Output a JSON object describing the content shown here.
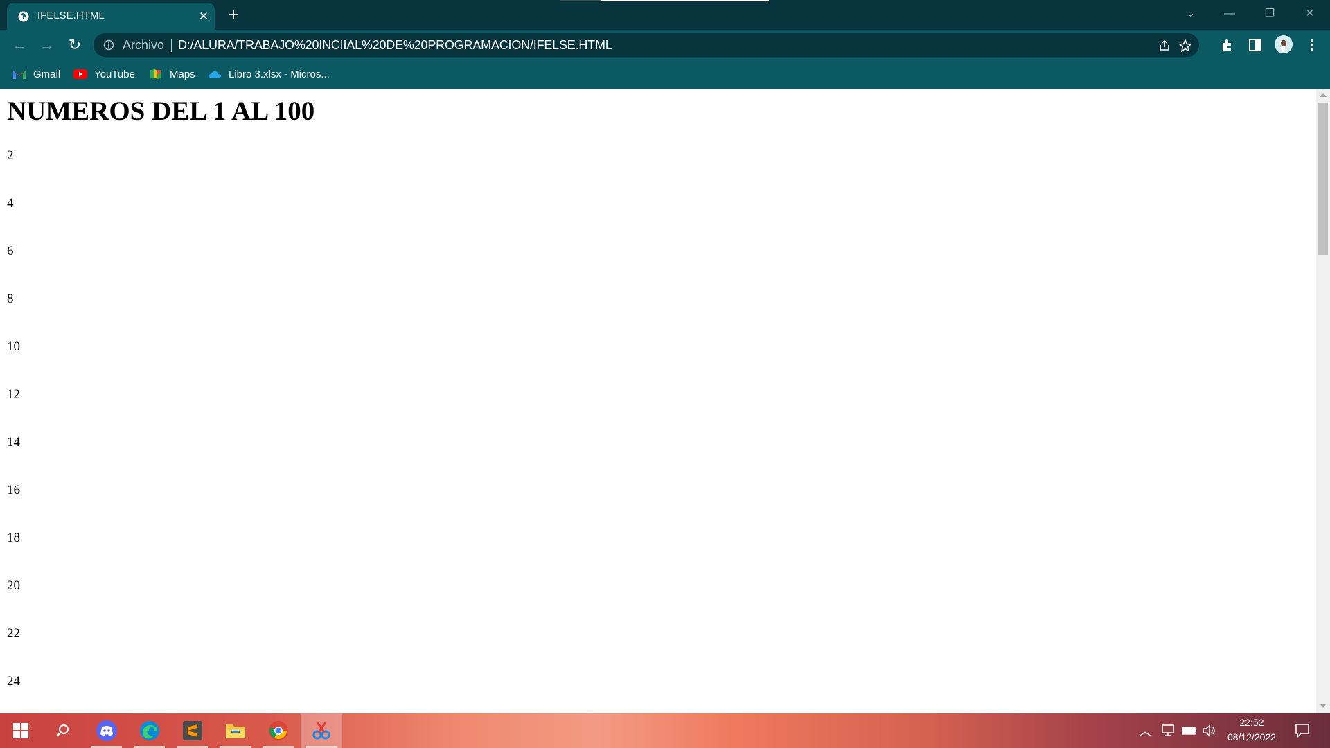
{
  "browser": {
    "tab": {
      "title": "IFELSE.HTML",
      "close_glyph": "✕"
    },
    "new_tab_glyph": "+",
    "window_controls": {
      "minimize": "—",
      "restore": "❐",
      "close": "✕",
      "tab_search": "⌄"
    },
    "omnibox": {
      "scheme_label": "Archivo",
      "url": "D:/ALURA/TRABAJO%20INCIIAL%20DE%20PROGRAMACION/IFELSE.HTML"
    },
    "nav": {
      "back": "←",
      "forward": "→",
      "reload": "↻"
    },
    "bookmarks": [
      {
        "label": "Gmail",
        "icon": "gmail-icon"
      },
      {
        "label": "YouTube",
        "icon": "youtube-icon"
      },
      {
        "label": "Maps",
        "icon": "maps-icon"
      },
      {
        "label": "Libro 3.xlsx - Micros...",
        "icon": "onedrive-icon"
      }
    ],
    "colors": {
      "titlebar": "#07333d",
      "toolbar": "#0b5a63"
    }
  },
  "page": {
    "heading": "NUMEROS DEL 1 AL 100",
    "numbers": [
      "2",
      "4",
      "6",
      "8",
      "10",
      "12",
      "14",
      "16",
      "18",
      "20",
      "22",
      "24"
    ]
  },
  "taskbar": {
    "apps": [
      "windows-start-icon",
      "search-icon",
      "discord-icon",
      "edge-icon",
      "sublime-text-icon",
      "file-explorer-icon",
      "chrome-icon",
      "snipping-tool-icon"
    ],
    "clock": {
      "time": "22:52",
      "date": "08/12/2022"
    }
  }
}
